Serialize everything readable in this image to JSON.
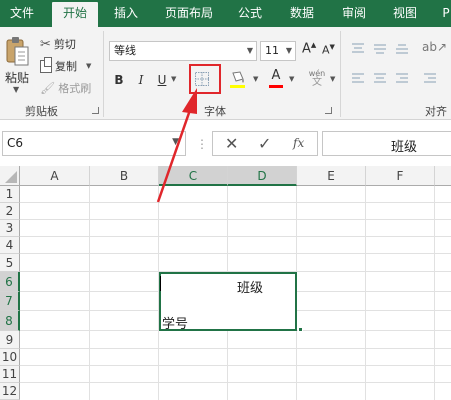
{
  "tabs": [
    "文件",
    "开始",
    "插入",
    "页面布局",
    "公式",
    "数据",
    "审阅",
    "视图",
    "P"
  ],
  "clipboard": {
    "paste_label": "粘贴",
    "cut_label": "剪切",
    "copy_label": "复制",
    "format_painter_label": "格式刷",
    "group_label": "剪贴板"
  },
  "font": {
    "name": "等线",
    "size": "11",
    "bold": "B",
    "italic": "I",
    "underline": "U",
    "grow": "A",
    "shrink": "A",
    "font_color_letter": "A",
    "phonetic_glyph": "wén",
    "group_label": "字体",
    "font_color": "#ff0000",
    "fill_color": "#ffff00"
  },
  "alignment": {
    "group_label": "对齐"
  },
  "formula_bar": {
    "name_box": "C6",
    "fx": "fx",
    "content": "班级"
  },
  "grid": {
    "columns": [
      "A",
      "B",
      "C",
      "D",
      "E",
      "F"
    ],
    "rows": [
      "1",
      "2",
      "3",
      "4",
      "5",
      "6",
      "7",
      "8",
      "9",
      "10",
      "11",
      "12"
    ],
    "selected_columns": [
      "C",
      "D"
    ],
    "selected_rows": [
      "6",
      "7",
      "8"
    ],
    "cell_texts": {
      "D6": "班级",
      "C8": "学号"
    }
  },
  "colors": {
    "accent": "#217346",
    "annotation_red": "#e0262b"
  }
}
